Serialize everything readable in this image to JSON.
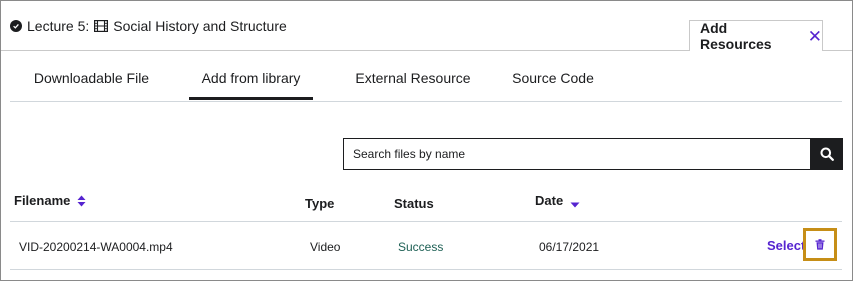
{
  "header": {
    "lecture_label": "Lecture 5:",
    "lecture_title": "Social History and Structure",
    "add_resources_label": "Add Resources",
    "close_icon": "close-icon",
    "check_icon": "check-circle-icon",
    "film_icon": "film-icon"
  },
  "tabs": [
    {
      "label": "Downloadable File",
      "active": false
    },
    {
      "label": "Add from library",
      "active": true
    },
    {
      "label": "External Resource",
      "active": false
    },
    {
      "label": "Source Code",
      "active": false
    }
  ],
  "search": {
    "placeholder": "Search files by name",
    "value": "",
    "icon": "search-icon"
  },
  "table": {
    "columns": [
      {
        "label": "Filename",
        "sort_icon": "sort-up-down-icon"
      },
      {
        "label": "Type"
      },
      {
        "label": "Status"
      },
      {
        "label": "Date",
        "sort_icon": "sort-down-icon"
      }
    ],
    "rows": [
      {
        "filename": "VID-20200214-WA0004.mp4",
        "type": "Video",
        "status": "Success",
        "date": "06/17/2021",
        "action_label": "Select",
        "delete_icon": "trash-icon"
      }
    ]
  },
  "colors": {
    "accent": "#5624d0",
    "success": "#1e6055",
    "highlight": "#c68e17",
    "text": "#1c1d1f"
  }
}
